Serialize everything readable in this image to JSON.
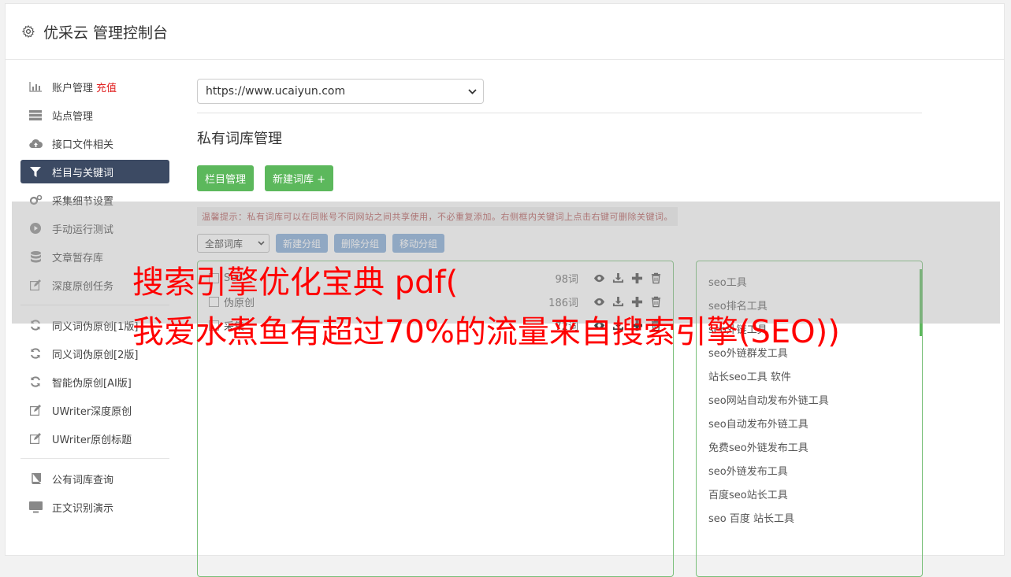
{
  "header": {
    "title": "优采云 管理控制台",
    "icon": "gear-icon"
  },
  "sidebar": {
    "items": [
      {
        "label": "账户管理",
        "icon": "bar-chart-icon",
        "badge": "充值"
      },
      {
        "label": "站点管理",
        "icon": "server-icon"
      },
      {
        "label": "接口文件相关",
        "icon": "cloud-upload-icon"
      },
      {
        "label": "栏目与关键词",
        "icon": "filter-icon",
        "active": true
      },
      {
        "label": "采集细节设置",
        "icon": "cogs-icon"
      },
      {
        "label": "手动运行测试",
        "icon": "play-circle-icon"
      },
      {
        "label": "文章暂存库",
        "icon": "database-icon"
      },
      {
        "label": "深度原创任务",
        "icon": "edit-icon"
      },
      {
        "label": "同义词伪原创[1版]",
        "icon": "refresh-icon"
      },
      {
        "label": "同义词伪原创[2版]",
        "icon": "refresh-icon"
      },
      {
        "label": "智能伪原创[AI版]",
        "icon": "refresh-icon"
      },
      {
        "label": "UWriter深度原创",
        "icon": "edit-icon"
      },
      {
        "label": "UWriter原创标题",
        "icon": "edit-icon"
      },
      {
        "label": "公有词库查询",
        "icon": "book-icon"
      },
      {
        "label": "正文识别演示",
        "icon": "monitor-icon"
      }
    ]
  },
  "main": {
    "site_select": "https://www.ucaiyun.com",
    "section_title": "私有词库管理",
    "buttons": {
      "column_manage": "栏目管理",
      "new_library": "新建词库 +"
    },
    "tip": "温馨提示：私有词库可以在同账号不同网站之间共享使用，不必重复添加。右侧框内关键词上点击右键可删除关键词。",
    "group_select": "全部词库",
    "group_buttons": {
      "new_group": "新建分组",
      "delete_group": "删除分组",
      "move_group": "移动分组"
    },
    "libraries": [
      {
        "name": "Seo",
        "count": "98词"
      },
      {
        "name": "伪原创",
        "count": "186词"
      },
      {
        "name": "采集",
        "count": "72词"
      }
    ],
    "keywords": [
      "seo工具",
      "seo排名工具",
      "seo外链工具",
      "seo外链群发工具",
      "站长seo工具 软件",
      "seo网站自动发布外链工具",
      "seo自动发布外链工具",
      "免费seo外链发布工具",
      "seo外链发布工具",
      "百度seo站长工具",
      "seo 百度 站长工具"
    ]
  },
  "watermark": {
    "line1": "搜索引擎优化宝典 pdf(",
    "line2": "我爱水煮鱼有超过70%的流量来自搜索引擎(SEO))"
  }
}
